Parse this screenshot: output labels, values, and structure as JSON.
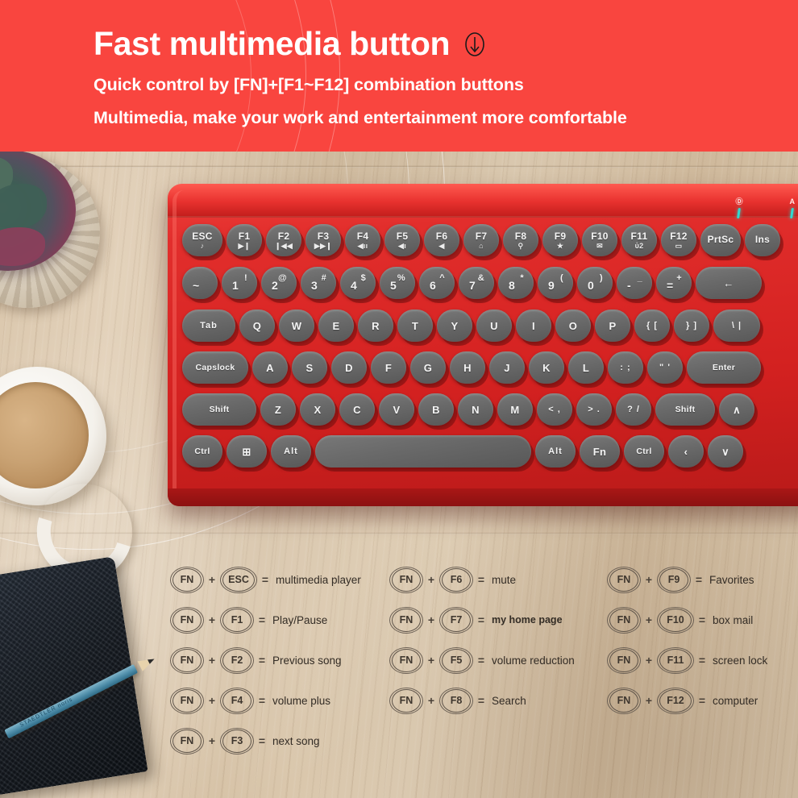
{
  "banner": {
    "headline": "Fast multimedia button",
    "headline_icon": "down-arrow-circle-icon",
    "subtitle1": "Quick control by [FN]+[F1~F12] combination buttons",
    "subtitle2": "Multimedia, make your work and entertainment more comfortable",
    "background_color": "#f9453f",
    "text_color": "#ffffff"
  },
  "keyboard": {
    "body_color": "#d32120",
    "keycap_color": "#686868",
    "indicators": [
      {
        "label": "Ⓓ",
        "name": "caps-lock-indicator",
        "color": "#2fd9d0"
      },
      {
        "label": "A",
        "name": "num-lock-indicator",
        "color": "#2fd9d0"
      }
    ],
    "rows": [
      {
        "name": "function-row",
        "keys": [
          {
            "label": "ESC",
            "icon": "♪",
            "w": "w50"
          },
          {
            "label": "F1",
            "icon": "▶❙",
            "w": "w44"
          },
          {
            "label": "F2",
            "icon": "❙◀◀",
            "w": "w44"
          },
          {
            "label": "F3",
            "icon": "▶▶❙",
            "w": "w44"
          },
          {
            "label": "F4",
            "icon": "◀ıı",
            "w": "w44"
          },
          {
            "label": "F5",
            "icon": "◀ı",
            "w": "w44"
          },
          {
            "label": "F6",
            "icon": "◀",
            "w": "w44"
          },
          {
            "label": "F7",
            "icon": "⌂",
            "w": "w44"
          },
          {
            "label": "F8",
            "icon": "⚲",
            "w": "w44"
          },
          {
            "label": "F9",
            "icon": "★",
            "w": "w44"
          },
          {
            "label": "F10",
            "icon": "✉",
            "w": "w44"
          },
          {
            "label": "F11",
            "icon": "ὑ2",
            "w": "w44"
          },
          {
            "label": "F12",
            "icon": "▭",
            "w": "w44"
          },
          {
            "label": "PrtSc",
            "icon": "",
            "w": "w50"
          },
          {
            "label": "Ins",
            "icon": "",
            "w": "w44"
          }
        ]
      },
      {
        "name": "number-row",
        "keys": [
          {
            "top": "",
            "bottom": "~",
            "w": "w44"
          },
          {
            "top": "!",
            "bottom": "1",
            "w": "w44"
          },
          {
            "top": "@",
            "bottom": "2",
            "w": "w44"
          },
          {
            "top": "#",
            "bottom": "3",
            "w": "w44"
          },
          {
            "top": "$",
            "bottom": "4",
            "w": "w44"
          },
          {
            "top": "%",
            "bottom": "5",
            "w": "w44"
          },
          {
            "top": "^",
            "bottom": "6",
            "w": "w44"
          },
          {
            "top": "&",
            "bottom": "7",
            "w": "w44"
          },
          {
            "top": "*",
            "bottom": "8",
            "w": "w44"
          },
          {
            "top": "(",
            "bottom": "9",
            "w": "w44"
          },
          {
            "top": ")",
            "bottom": "0",
            "w": "w44"
          },
          {
            "top": "_",
            "bottom": "-",
            "w": "w44"
          },
          {
            "top": "+",
            "bottom": "=",
            "w": "w44"
          },
          {
            "label": "←",
            "w": "w82",
            "wide": true
          }
        ]
      },
      {
        "name": "qwerty-row",
        "keys": [
          {
            "label": "Tab",
            "w": "w66",
            "wide": true
          },
          {
            "label": "Q",
            "w": "w44"
          },
          {
            "label": "W",
            "w": "w44"
          },
          {
            "label": "E",
            "w": "w44"
          },
          {
            "label": "R",
            "w": "w44"
          },
          {
            "label": "T",
            "w": "w44"
          },
          {
            "label": "Y",
            "w": "w44"
          },
          {
            "label": "U",
            "w": "w44"
          },
          {
            "label": "I",
            "w": "w44"
          },
          {
            "label": "O",
            "w": "w44"
          },
          {
            "label": "P",
            "w": "w44"
          },
          {
            "label": "{ [",
            "w": "w44"
          },
          {
            "label": "} ]",
            "w": "w44"
          },
          {
            "label": "\\ |",
            "w": "w58",
            "wide": true
          }
        ]
      },
      {
        "name": "home-row",
        "keys": [
          {
            "label": "Capslock",
            "w": "w82",
            "wide": true
          },
          {
            "label": "A",
            "w": "w44"
          },
          {
            "label": "S",
            "w": "w44"
          },
          {
            "label": "D",
            "w": "w44"
          },
          {
            "label": "F",
            "w": "w44"
          },
          {
            "label": "G",
            "w": "w44"
          },
          {
            "label": "H",
            "w": "w44"
          },
          {
            "label": "J",
            "w": "w44"
          },
          {
            "label": "K",
            "w": "w44"
          },
          {
            "label": "L",
            "w": "w44"
          },
          {
            "label": ": ;",
            "w": "w44"
          },
          {
            "label": "\" '",
            "w": "w44"
          },
          {
            "label": "Enter",
            "w": "w92",
            "wide": true
          }
        ]
      },
      {
        "name": "shift-row",
        "keys": [
          {
            "label": "Shift",
            "w": "w92",
            "wide": true
          },
          {
            "label": "Z",
            "w": "w44"
          },
          {
            "label": "X",
            "w": "w44"
          },
          {
            "label": "C",
            "w": "w44"
          },
          {
            "label": "V",
            "w": "w44"
          },
          {
            "label": "B",
            "w": "w44"
          },
          {
            "label": "N",
            "w": "w44"
          },
          {
            "label": "M",
            "w": "w44"
          },
          {
            "label": "< ,",
            "w": "w44"
          },
          {
            "label": "> .",
            "w": "w44"
          },
          {
            "label": "? /",
            "w": "w44"
          },
          {
            "label": "Shift",
            "w": "w74",
            "wide": true
          },
          {
            "label": "∧",
            "w": "w44"
          }
        ]
      },
      {
        "name": "bottom-row",
        "keys": [
          {
            "label": "Ctrl",
            "w": "w50"
          },
          {
            "label": "⊞",
            "w": "w50"
          },
          {
            "label": "Alt",
            "w": "w50"
          },
          {
            "label": "",
            "w": "w268",
            "wide": true
          },
          {
            "label": "Alt",
            "w": "w50"
          },
          {
            "label": "Fn",
            "w": "w50"
          },
          {
            "label": "Ctrl",
            "w": "w50"
          },
          {
            "label": "‹",
            "w": "w44"
          },
          {
            "label": "∨",
            "w": "w44"
          }
        ]
      }
    ]
  },
  "legend": {
    "modifier": "FN",
    "plus": "+",
    "equals": "=",
    "columns": [
      {
        "name": "legend-column-1",
        "rows": [
          {
            "key": "ESC",
            "desc": "multimedia player",
            "wide": true
          },
          {
            "key": "F1",
            "desc": "Play/Pause"
          },
          {
            "key": "F2",
            "desc": "Previous song"
          },
          {
            "key": "F4",
            "desc": "volume plus"
          },
          {
            "key": "F3",
            "desc": "next song"
          }
        ]
      },
      {
        "name": "legend-column-2",
        "rows": [
          {
            "key": "F6",
            "desc": "mute"
          },
          {
            "key": "F7",
            "desc": "my home page",
            "bold": true
          },
          {
            "key": "F5",
            "desc": "volume reduction"
          },
          {
            "key": "F8",
            "desc": "Search"
          }
        ]
      },
      {
        "name": "legend-column-3",
        "rows": [
          {
            "key": "F9",
            "desc": "Favorites"
          },
          {
            "key": "F10",
            "desc": "box mail",
            "wide": true
          },
          {
            "key": "F11",
            "desc": "screen lock",
            "wide": true
          },
          {
            "key": "F12",
            "desc": "computer",
            "wide": true
          }
        ]
      }
    ]
  },
  "scene": {
    "desk_color": "#d8c4a9",
    "props": [
      "succulent-plant",
      "wicker-basket",
      "coffee-mug",
      "notebook",
      "pencil"
    ]
  }
}
